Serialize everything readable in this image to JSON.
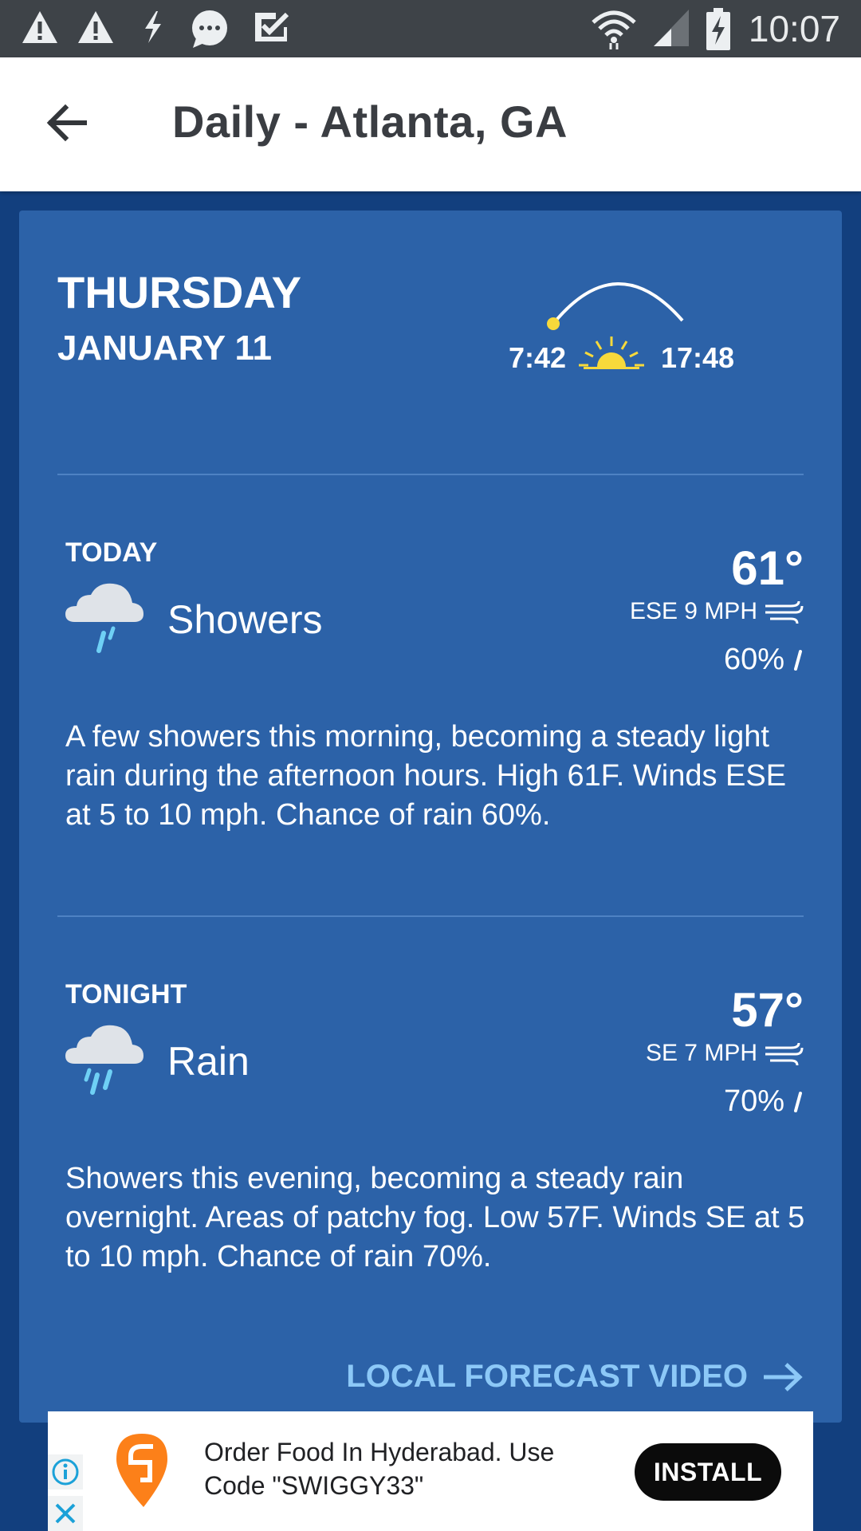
{
  "status_bar": {
    "time": "10:07",
    "left_icons": [
      "warning-icon",
      "warning-icon",
      "flash-icon",
      "chat-bubble-icon",
      "task-check-icon"
    ],
    "right_icons": [
      "wifi-icon",
      "cell-signal-icon",
      "battery-charging-icon"
    ]
  },
  "app_bar": {
    "back_icon": "arrow-back-icon",
    "title": "Daily - Atlanta, GA"
  },
  "day": {
    "name": "THURSDAY",
    "date": "JANUARY 11",
    "sunrise": "7:42",
    "sunset": "17:48"
  },
  "periods": [
    {
      "label": "TODAY",
      "condition": "Showers",
      "icon": "showers-icon",
      "temp": "61°",
      "wind": "ESE 9 MPH",
      "precip": "60%",
      "description": "A few showers this morning, becoming a steady light rain during the afternoon hours. High 61F. Winds ESE at 5 to 10 mph. Chance of rain 60%."
    },
    {
      "label": "TONIGHT",
      "condition": "Rain",
      "icon": "rain-icon",
      "temp": "57°",
      "wind": "SE 7 MPH",
      "precip": "70%",
      "description": "Showers this evening, becoming a steady rain overnight. Areas of patchy fog. Low 57F. Winds SE at 5 to 10 mph. Chance of rain 70%."
    }
  ],
  "video_link": {
    "label": "LOCAL FORECAST VIDEO"
  },
  "ad": {
    "text": "Order Food In Hyderabad. Use Code \"SWIGGY33\"",
    "button": "INSTALL"
  },
  "colors": {
    "page_bg": "#123f7e",
    "card_bg": "#2c62a8",
    "accent_link": "#8cc8f7",
    "sun": "#f7d93b",
    "rain_drop": "#6fd0f5"
  }
}
